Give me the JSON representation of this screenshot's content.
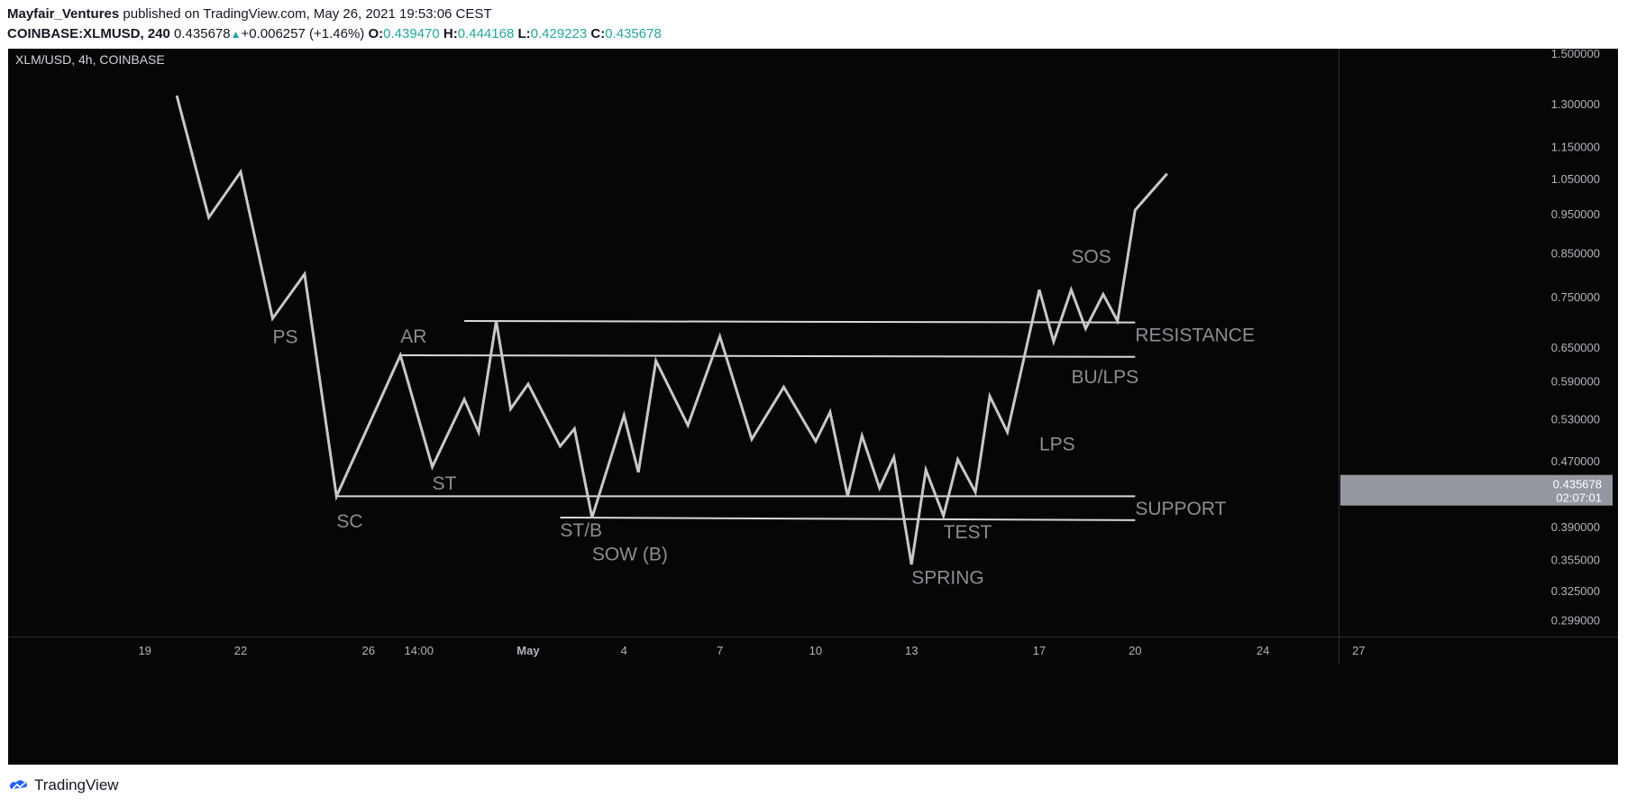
{
  "header": {
    "author": "Mayfair_Ventures",
    "published": "published on TradingView.com, May 26, 2021 19:53:06 CEST",
    "symbol": "COINBASE:XLMUSD, 240",
    "last": "0.435678",
    "change": "+0.006257 (+1.46%)",
    "o_label": "O:",
    "o_val": "0.439470",
    "h_label": "H:",
    "h_val": "0.444168",
    "l_label": "L:",
    "l_val": "0.429223",
    "c_label": "C:",
    "c_val": "0.435678"
  },
  "chart_data": {
    "type": "line",
    "title": "XLM/USD, 4h, COINBASE",
    "y_scale": "log",
    "ylim": [
      0.285,
      1.52
    ],
    "y_ticks": [
      "1.500000",
      "1.300000",
      "1.150000",
      "1.050000",
      "0.950000",
      "0.850000",
      "0.750000",
      "0.650000",
      "0.590000",
      "0.530000",
      "0.470000",
      "0.390000",
      "0.355000",
      "0.325000",
      "0.299000"
    ],
    "x_ticks": [
      "19",
      "22",
      "26",
      "14:00",
      "May",
      "4",
      "7",
      "10",
      "13",
      "17",
      "20",
      "24",
      "27"
    ],
    "x_ticks_bold": [
      "May"
    ],
    "price_label": {
      "value": "0.435678",
      "countdown": "02:07:01"
    },
    "series": [
      {
        "x": [
          "Apr 20 2021",
          "Apr 21 2021",
          "Apr 22 2021",
          "Apr 23 2021",
          "Apr 24 2021",
          "Apr 25 2021",
          "Apr 27 2021",
          "Apr 28 2021",
          "Apr 29 2021",
          "Apr 29 2021",
          "Apr 30 2021",
          "Apr 30 2021",
          "May 1 2021",
          "May 2 2021",
          "May 2 2021",
          "May 3 2021",
          "May 4 2021",
          "May 4 2021",
          "May 5 2021",
          "May 6 2021",
          "May 7 2021",
          "May 8 2021",
          "May 9 2021",
          "May 10 2021",
          "May 10 2021",
          "May 11 2021",
          "May 11 2021",
          "May 12 2021",
          "May 12 2021",
          "May 13 2021",
          "May 13 2021",
          "May 14 2021",
          "May 14 2021",
          "May 15 2021",
          "May 15 2021",
          "May 16 2021",
          "May 17 2021",
          "May 17 2021",
          "May 18 2021",
          "May 18 2021",
          "May 19 2021",
          "May 19 2021",
          "May 20 2021",
          "May 21 2021"
        ],
        "y": [
          1.33,
          0.94,
          1.07,
          0.705,
          0.8,
          0.425,
          0.635,
          0.462,
          0.56,
          0.51,
          0.7,
          0.545,
          0.585,
          0.49,
          0.515,
          0.4,
          0.535,
          0.455,
          0.625,
          0.52,
          0.67,
          0.5,
          0.58,
          0.497,
          0.54,
          0.425,
          0.505,
          0.435,
          0.475,
          0.35,
          0.458,
          0.402,
          0.472,
          0.43,
          0.565,
          0.51,
          0.765,
          0.66,
          0.765,
          0.685,
          0.755,
          0.7,
          0.96,
          1.065
        ]
      }
    ],
    "levels": [
      {
        "x1": "Apr 29 2021",
        "y1": 0.7,
        "x2": "May 20 2021",
        "y2": 0.697
      },
      {
        "x1": "Apr 27 2021",
        "y1": 0.635,
        "x2": "May 20 2021",
        "y2": 0.632
      },
      {
        "x1": "Apr 25 2021",
        "y1": 0.425,
        "x2": "May 20 2021",
        "y2": 0.425
      },
      {
        "x1": "May 2 2021",
        "y1": 0.4,
        "x2": "May 20 2021",
        "y2": 0.397
      }
    ],
    "annotations": [
      {
        "text": "PS",
        "x": "Apr 23 2021",
        "y": 0.657
      },
      {
        "text": "AR",
        "x": "Apr 27 2021",
        "y": 0.658
      },
      {
        "text": "SC",
        "x": "Apr 25 2021",
        "y": 0.389
      },
      {
        "text": "ST",
        "x": "Apr 28 2021",
        "y": 0.433
      },
      {
        "text": "ST/B",
        "x": "May 2 2021",
        "y": 0.379
      },
      {
        "text": "SOW (B)",
        "x": "May 3 2021",
        "y": 0.354
      },
      {
        "text": "SPRING",
        "x": "May 13 2021",
        "y": 0.331
      },
      {
        "text": "TEST",
        "x": "May 14 2021",
        "y": 0.377
      },
      {
        "text": "LPS",
        "x": "May 17 2021",
        "y": 0.484
      },
      {
        "text": "BU/LPS",
        "x": "May 18 2021",
        "y": 0.586
      },
      {
        "text": "SOS",
        "x": "May 18 2021",
        "y": 0.826
      },
      {
        "text": "RESISTANCE",
        "x": "May 20 2021",
        "y": 0.661
      },
      {
        "text": "SUPPORT",
        "x": "May 20 2021",
        "y": 0.403
      }
    ],
    "colors": {
      "background": "#060606",
      "line": "#c8c8c8",
      "text": "#8a8d93",
      "axis_text": "#b2b5be",
      "accent": "#26a69a"
    }
  },
  "footer": {
    "brand": "TradingView"
  }
}
